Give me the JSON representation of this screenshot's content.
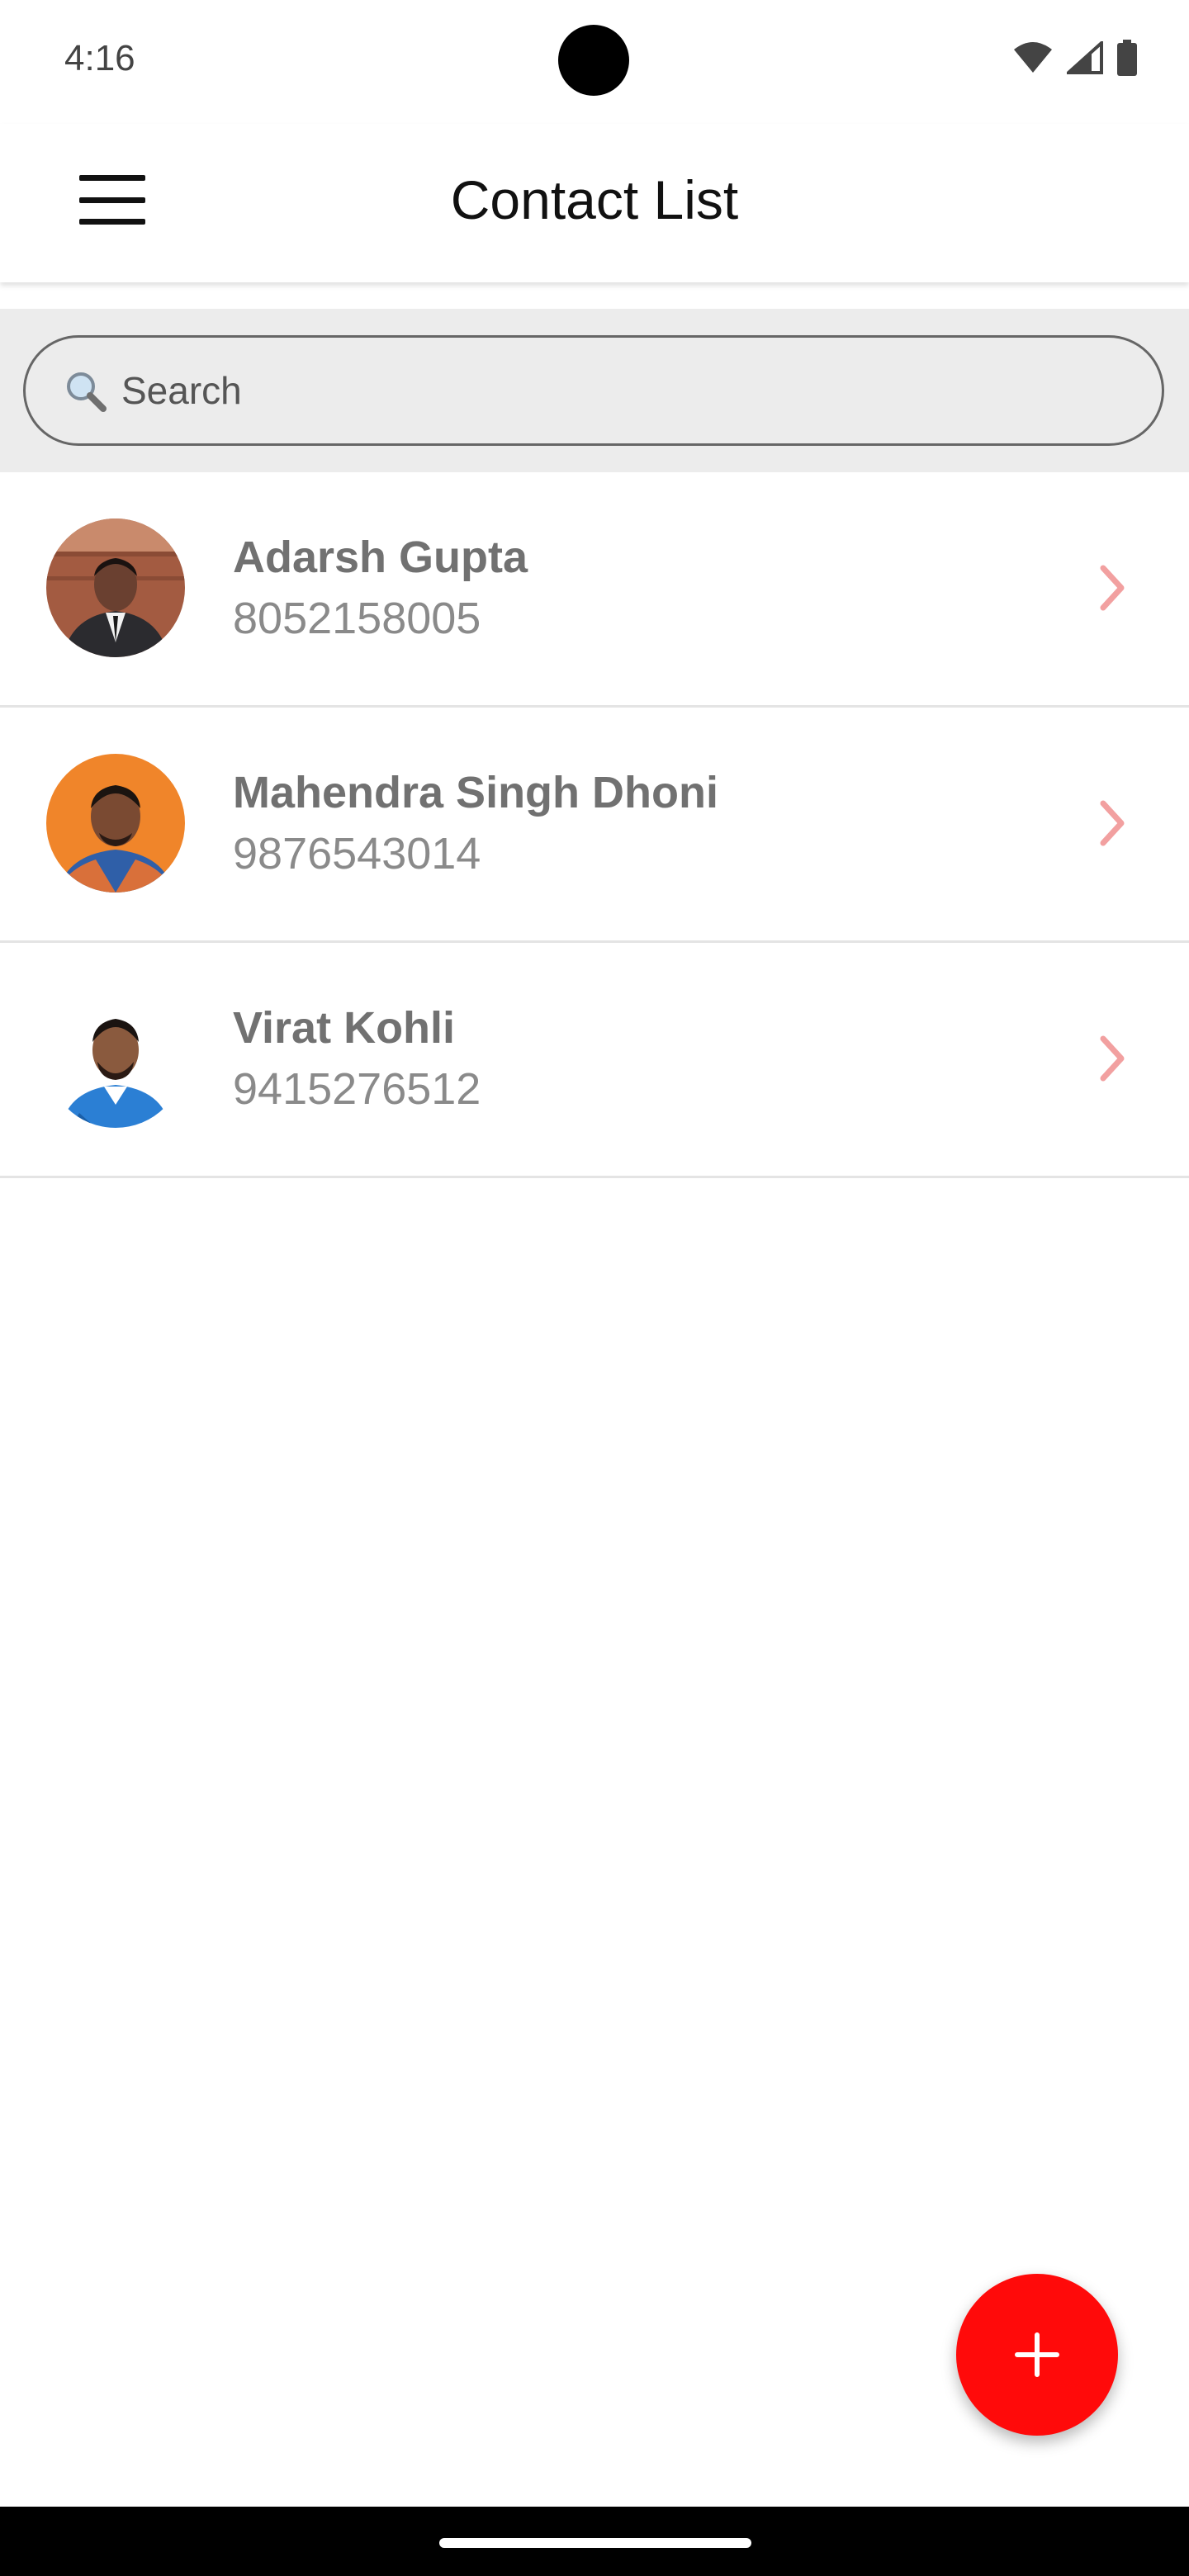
{
  "status_bar": {
    "time": "4:16",
    "icons": [
      "wifi-icon",
      "signal-icon",
      "battery-icon"
    ]
  },
  "app_bar": {
    "title": "Contact List",
    "menu_icon": "hamburger-menu-icon"
  },
  "search": {
    "placeholder": "Search",
    "value": "",
    "icon": "search-icon"
  },
  "contacts": [
    {
      "name": "Adarsh Gupta",
      "phone": "8052158005",
      "avatar": "person-photo-avatar"
    },
    {
      "name": "Mahendra Singh Dhoni",
      "phone": "9876543014",
      "avatar": "person-photo-avatar"
    },
    {
      "name": "Virat Kohli",
      "phone": "9415276512",
      "avatar": "person-photo-avatar"
    }
  ],
  "fab": {
    "icon": "plus-icon"
  },
  "colors": {
    "accent": "#ff0a0a",
    "chevron": "#f2a0a0",
    "search_bg": "#ececec",
    "name_text": "#717171",
    "phone_text": "#8a8a8a"
  }
}
